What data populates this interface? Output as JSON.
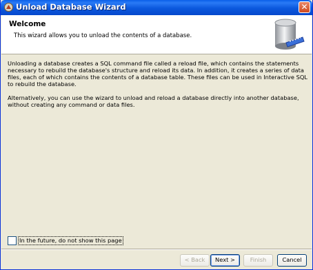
{
  "window": {
    "title": "Unload Database Wizard"
  },
  "header": {
    "title": "Welcome",
    "subtitle": "This wizard allows you to unload the contents of a database."
  },
  "body": {
    "paragraphs": [
      "Unloading a database creates a SQL command file called a reload file, which contains the statements necessary to rebuild the database's structure and reload its data. In addition, it creates a series of data files, each of which contains the contents of a database table. These files can be used in Interactive SQL to rebuild the database.",
      "Alternatively, you can use the wizard to unload and reload a database directly into another database, without creating any command or data files."
    ]
  },
  "checkbox": {
    "label": "In the future, do not show this page",
    "checked": false
  },
  "buttons": {
    "back": "< Back",
    "next": "Next >",
    "finish": "Finish",
    "cancel": "Cancel"
  },
  "icons": {
    "title": "wizard-icon",
    "header": "database-icon"
  }
}
